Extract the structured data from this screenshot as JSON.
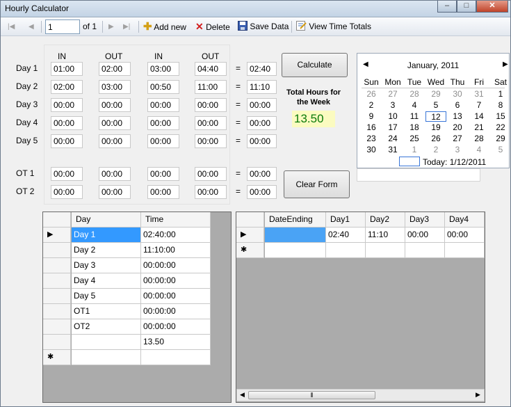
{
  "window": {
    "title": "Hourly Calculator",
    "min": "–",
    "max": "□",
    "close": "✕"
  },
  "toolbar": {
    "first": "|◀",
    "prev": "◀",
    "position": "1",
    "of_label": "of 1",
    "next": "▶",
    "last": "▶|",
    "add_new": "Add new",
    "delete": "Delete",
    "save": "Save Data",
    "view_totals": "View Time Totals"
  },
  "entry": {
    "headers": [
      "IN",
      "OUT",
      "IN",
      "OUT"
    ],
    "rows": [
      {
        "label": "Day 1",
        "t": [
          "01:00",
          "02:00",
          "03:00",
          "04:40"
        ],
        "eq": "=",
        "r": "02:40"
      },
      {
        "label": "Day 2",
        "t": [
          "02:00",
          "03:00",
          "00:50",
          "11:00"
        ],
        "eq": "=",
        "r": "11:10"
      },
      {
        "label": "Day 3",
        "t": [
          "00:00",
          "00:00",
          "00:00",
          "00:00"
        ],
        "eq": "=",
        "r": "00:00"
      },
      {
        "label": "Day 4",
        "t": [
          "00:00",
          "00:00",
          "00:00",
          "00:00"
        ],
        "eq": "=",
        "r": "00:00"
      },
      {
        "label": "Day 5",
        "t": [
          "00:00",
          "00:00",
          "00:00",
          "00:00"
        ],
        "eq": "=",
        "r": "00:00"
      },
      {
        "label": "OT 1",
        "t": [
          "00:00",
          "00:00",
          "00:00",
          "00:00"
        ],
        "eq": "=",
        "r": "00:00"
      },
      {
        "label": "OT 2",
        "t": [
          "00:00",
          "00:00",
          "00:00",
          "00:00"
        ],
        "eq": "=",
        "r": "00:00"
      }
    ]
  },
  "buttons": {
    "calculate": "Calculate",
    "clear": "Clear Form"
  },
  "total": {
    "label": "Total Hours for the Week",
    "value": "13.50"
  },
  "calendar": {
    "month": "January, 2011",
    "prev": "◀",
    "next": "▶",
    "day_names": [
      "Sun",
      "Mon",
      "Tue",
      "Wed",
      "Thu",
      "Fri",
      "Sat"
    ],
    "weeks": [
      [
        "26",
        "27",
        "28",
        "29",
        "30",
        "31",
        "1"
      ],
      [
        "2",
        "3",
        "4",
        "5",
        "6",
        "7",
        "8"
      ],
      [
        "9",
        "10",
        "11",
        "12",
        "13",
        "14",
        "15"
      ],
      [
        "16",
        "17",
        "18",
        "19",
        "20",
        "21",
        "22"
      ],
      [
        "23",
        "24",
        "25",
        "26",
        "27",
        "28",
        "29"
      ],
      [
        "30",
        "31",
        "1",
        "2",
        "3",
        "4",
        "5"
      ]
    ],
    "today": "Today: 1/12/2011"
  },
  "grid1": {
    "columns": [
      "Day",
      "Time"
    ],
    "rows": [
      [
        "Day 1",
        "02:40:00"
      ],
      [
        "Day 2",
        "11:10:00"
      ],
      [
        "Day 3",
        "00:00:00"
      ],
      [
        "Day 4",
        "00:00:00"
      ],
      [
        "Day 5",
        "00:00:00"
      ],
      [
        "OT1",
        "00:00:00"
      ],
      [
        "OT2",
        "00:00:00"
      ],
      [
        "",
        "13.50"
      ]
    ],
    "current": "▶",
    "new": "✱"
  },
  "grid2": {
    "columns": [
      "DateEnding",
      "Day1",
      "Day2",
      "Day3",
      "Day4"
    ],
    "row": [
      "",
      "02:40",
      "11:10",
      "00:00",
      "00:00"
    ],
    "current": "▶",
    "new": "✱",
    "scroll_left": "◀",
    "scroll_right": "▶",
    "scroll_grip": "⦀"
  }
}
